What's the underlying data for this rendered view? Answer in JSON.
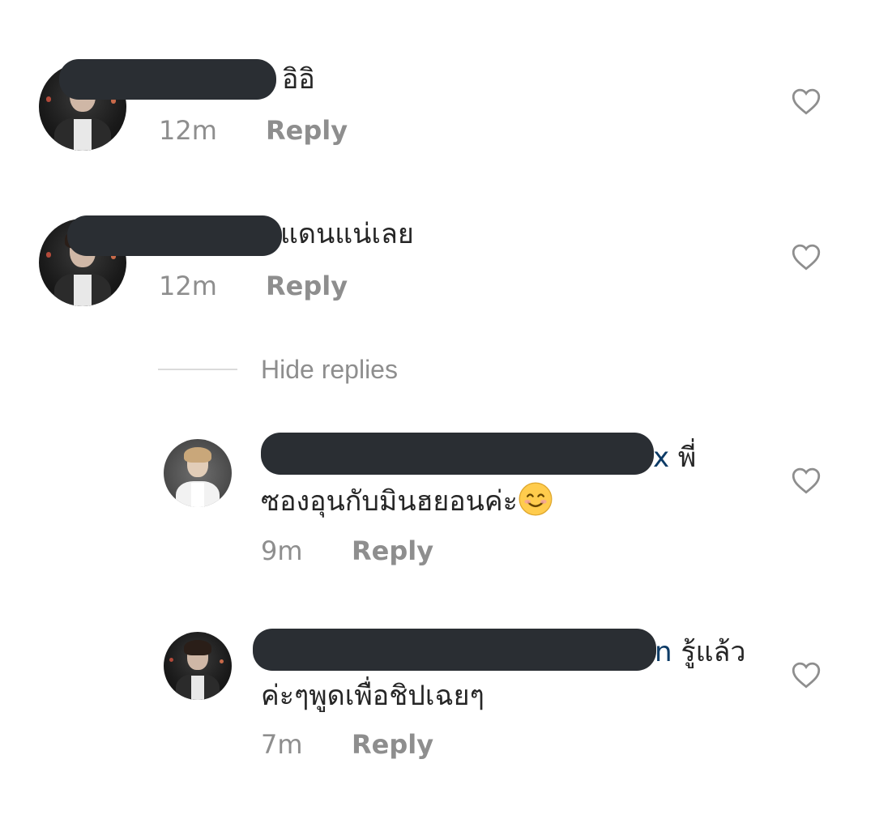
{
  "comments": [
    {
      "text": "อิอิ",
      "time": "12m",
      "reply_label": "Reply"
    },
    {
      "text": "แดนแน่เลย",
      "time": "12m",
      "reply_label": "Reply"
    }
  ],
  "hide_replies_label": "Hide replies",
  "replies": [
    {
      "mention_tail": "x",
      "line1_rest": " พี่",
      "line2": "ซองอุนกับมินฮยอนค่ะ",
      "emoji": "smiling-face-emoji",
      "time": "9m",
      "reply_label": "Reply"
    },
    {
      "mention_tail": "n",
      "line1_rest": " รู้แล้ว",
      "line2": "ค่ะๆพูดเพื่อชิปเฉยๆ",
      "time": "7m",
      "reply_label": "Reply"
    }
  ],
  "icons": {
    "like": "heart-outline-icon"
  },
  "colors": {
    "text": "#262626",
    "meta": "#8e8e8e",
    "mention": "#0d3b66",
    "redaction": "#2a2e33"
  }
}
